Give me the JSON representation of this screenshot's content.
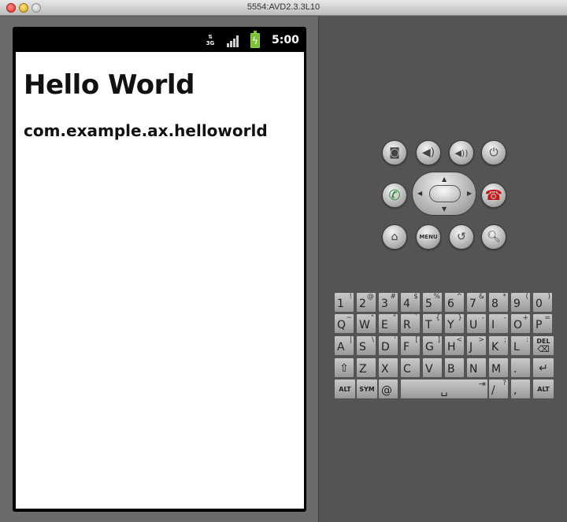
{
  "window": {
    "title": "5554:AVD2.3.3L10"
  },
  "status_bar": {
    "network": "3G",
    "time": "5:00"
  },
  "app": {
    "title": "Hello World",
    "package": "com.example.ax.helloworld"
  },
  "controls": {
    "menu_label": "MENU"
  },
  "keyboard": {
    "row1": [
      {
        "m": "1",
        "a": "!"
      },
      {
        "m": "2",
        "a": "@"
      },
      {
        "m": "3",
        "a": "#"
      },
      {
        "m": "4",
        "a": "$"
      },
      {
        "m": "5",
        "a": "%"
      },
      {
        "m": "6",
        "a": "^"
      },
      {
        "m": "7",
        "a": "&"
      },
      {
        "m": "8",
        "a": "*"
      },
      {
        "m": "9",
        "a": "("
      },
      {
        "m": "0",
        "a": ")"
      }
    ],
    "row2": [
      {
        "m": "Q",
        "a": "~"
      },
      {
        "m": "W",
        "a": "\""
      },
      {
        "m": "E",
        "a": "\""
      },
      {
        "m": "R",
        "a": "`"
      },
      {
        "m": "T",
        "a": "{"
      },
      {
        "m": "Y",
        "a": "}"
      },
      {
        "m": "U",
        "a": "-"
      },
      {
        "m": "I",
        "a": "-"
      },
      {
        "m": "O",
        "a": "+"
      },
      {
        "m": "P",
        "a": "="
      }
    ],
    "row3": [
      {
        "m": "A",
        "a": "|"
      },
      {
        "m": "S",
        "a": "\\"
      },
      {
        "m": "D",
        "a": "'"
      },
      {
        "m": "F",
        "a": "["
      },
      {
        "m": "G",
        "a": "]"
      },
      {
        "m": "H",
        "a": "<"
      },
      {
        "m": "J",
        "a": ">"
      },
      {
        "m": "K",
        "a": ";"
      },
      {
        "m": "L",
        "a": ":"
      }
    ],
    "del_label": "DEL",
    "row4": [
      {
        "m": "Z",
        "a": ""
      },
      {
        "m": "X",
        "a": ""
      },
      {
        "m": "C",
        "a": ""
      },
      {
        "m": "V",
        "a": ""
      },
      {
        "m": "B",
        "a": ""
      },
      {
        "m": "N",
        "a": ""
      },
      {
        "m": "M",
        "a": ""
      },
      {
        "m": ".",
        "a": ""
      }
    ],
    "alt_label": "ALT",
    "sym_label": "SYM",
    "at_label": "@",
    "slash_label": "/",
    "slash_alt": "?",
    "comma_label": ","
  }
}
